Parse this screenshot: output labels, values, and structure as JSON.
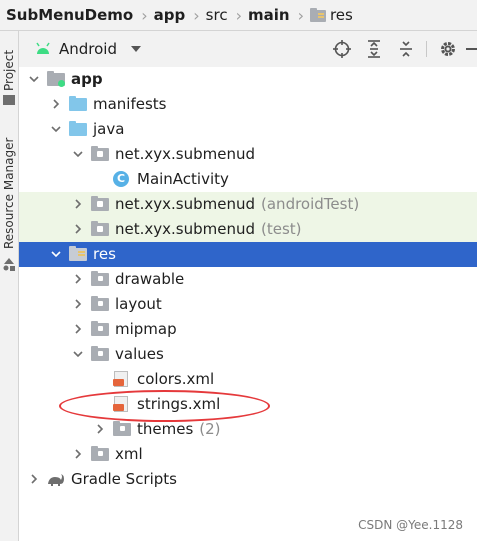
{
  "breadcrumb": [
    "SubMenuDemo",
    "app",
    "src",
    "main",
    "res"
  ],
  "left_strip": {
    "project_tab": "Project",
    "resource_manager_tab": "Resource Manager"
  },
  "header": {
    "view_mode": "Android"
  },
  "tree": [
    {
      "label": "app",
      "suffix": ""
    },
    {
      "label": "manifests",
      "suffix": ""
    },
    {
      "label": "java",
      "suffix": ""
    },
    {
      "label": "net.xyx.submenud",
      "suffix": ""
    },
    {
      "label": "MainActivity",
      "suffix": ""
    },
    {
      "label": "net.xyx.submenud",
      "suffix": "(androidTest)"
    },
    {
      "label": "net.xyx.submenud",
      "suffix": "(test)"
    },
    {
      "label": "res",
      "suffix": ""
    },
    {
      "label": "drawable",
      "suffix": ""
    },
    {
      "label": "layout",
      "suffix": ""
    },
    {
      "label": "mipmap",
      "suffix": ""
    },
    {
      "label": "values",
      "suffix": ""
    },
    {
      "label": "colors.xml",
      "suffix": ""
    },
    {
      "label": "strings.xml",
      "suffix": ""
    },
    {
      "label": "themes",
      "suffix": "(2)"
    },
    {
      "label": "xml",
      "suffix": ""
    },
    {
      "label": "Gradle Scripts",
      "suffix": ""
    }
  ],
  "watermark": "CSDN @Yee.1128",
  "colors": {
    "selection": "#2f65ca",
    "test_row": "#eef6e6",
    "annotation": "#e5393b",
    "android_green": "#3ddc84"
  }
}
